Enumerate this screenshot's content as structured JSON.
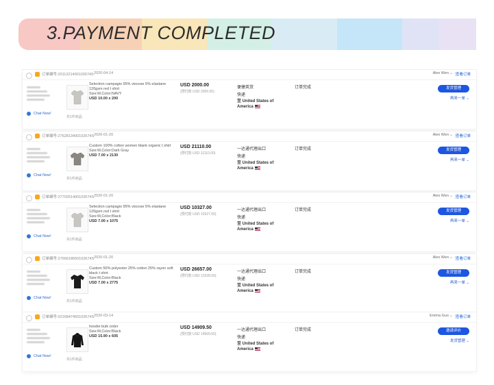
{
  "banner": {
    "title": "3.PAYMENT COMPLETED",
    "colors": [
      "#f7c8c4",
      "#f7d1b6",
      "#f9e6b9",
      "#d4f0e6",
      "#d9ecf6",
      "#c4e6f8",
      "#e0e3f5",
      "#e9e2f4"
    ]
  },
  "accent_color": "#1d56e0",
  "orders": [
    {
      "order_number": "订单编号:2011221400102674S",
      "date": "2020-04-14",
      "seller": "Alex Wen",
      "detail_link": "查看订单",
      "chat_label": "Chat Now!",
      "product_icon": "light-tshirt-icon",
      "item_count": "共1件商品",
      "description": "Selection campagio 95% viscose 5% elastane 120gsm red t shirt",
      "spec": "Size:M,Color:NAVY",
      "quantity": "USD 10.00 x 200",
      "price": "USD 2000.00",
      "price_sub": "(预付款 USD 2000.00)",
      "shipping": "便捷英货",
      "shipping_mode": "快递",
      "destination": "至 United States of America",
      "status": "订单完成",
      "action_button": "发货管理",
      "action_link": "再来一单"
    },
    {
      "order_number": "订单编号:2762813400102674S",
      "date": "2020-01-20",
      "seller": "Alex Wen",
      "detail_link": "查看订单",
      "chat_label": "Chat Now!",
      "product_icon": "grey-tshirt-icon",
      "item_count": "共1件商品",
      "description": "Custom 100% cotton women blank organic t shirt",
      "spec": "Size:M,Color:Dark Gray",
      "quantity": "USD 7.00 x 2130",
      "price": "USD 21110.00",
      "price_sub": "(预付款 USD 11110.00)",
      "shipping": "一达通代理出口",
      "shipping_mode": "快递",
      "destination": "至 United States of America",
      "status": "订单完成",
      "action_button": "发货管理",
      "action_link": "再来一单"
    },
    {
      "order_number": "订单编号:2770261400102674S",
      "date": "2020-01-20",
      "seller": "Alex Wen",
      "detail_link": "查看订单",
      "chat_label": "Chat Now!",
      "product_icon": "light-tshirt-icon",
      "item_count": "共1件商品",
      "description": "Selection campagio 95% viscose 5% elastane 120gsm red t shirt",
      "spec": "Size:M,Color:Black",
      "quantity": "USD 7.00 x 1075",
      "price": "USD 10327.00",
      "price_sub": "(预付款 USD 10327.00)",
      "shipping": "一达通代理出口",
      "shipping_mode": "快递",
      "destination": "至 United States of America",
      "status": "订单完成",
      "action_button": "发货管理",
      "action_link": "再来一单"
    },
    {
      "order_number": "订单编号:2766618650102674S",
      "date": "2020-01-20",
      "seller": "Alex Wen",
      "detail_link": "查看订单",
      "chat_label": "Chat Now!",
      "product_icon": "black-tshirt-icon",
      "item_count": "共1件商品",
      "description": "Custom 50% polyester 25% cotton 25% rayon soft black t shirt",
      "spec": "Size:M,Color:Black",
      "quantity": "USD 7.00 x 2775",
      "price": "USD 26657.00",
      "price_sub": "(预付款 USD 13328.00)",
      "shipping": "一达通代理出口",
      "shipping_mode": "快递",
      "destination": "至 United States of America",
      "status": "订单完成",
      "action_button": "发货管理",
      "action_link": "再来一单"
    },
    {
      "order_number": "订单编号:0216847450102674S",
      "date": "2020-03-14",
      "seller": "Emma Guo",
      "detail_link": "查看订单",
      "chat_label": "Chat Now!",
      "product_icon": "black-hoodie-icon",
      "item_count": "共1件商品",
      "description": "hoodie bulk order",
      "spec": "Size:M,Color:Black",
      "quantity": "USD 15.90 x 605",
      "price": "USD 14909.50",
      "price_sub": "(预付款 USD 14909.50)",
      "shipping": "一达通代理出口",
      "shipping_mode": "快递",
      "destination": "至 United States of America",
      "status": "订单完成",
      "action_button": "邀请评价",
      "action_link": "发货管理"
    }
  ]
}
